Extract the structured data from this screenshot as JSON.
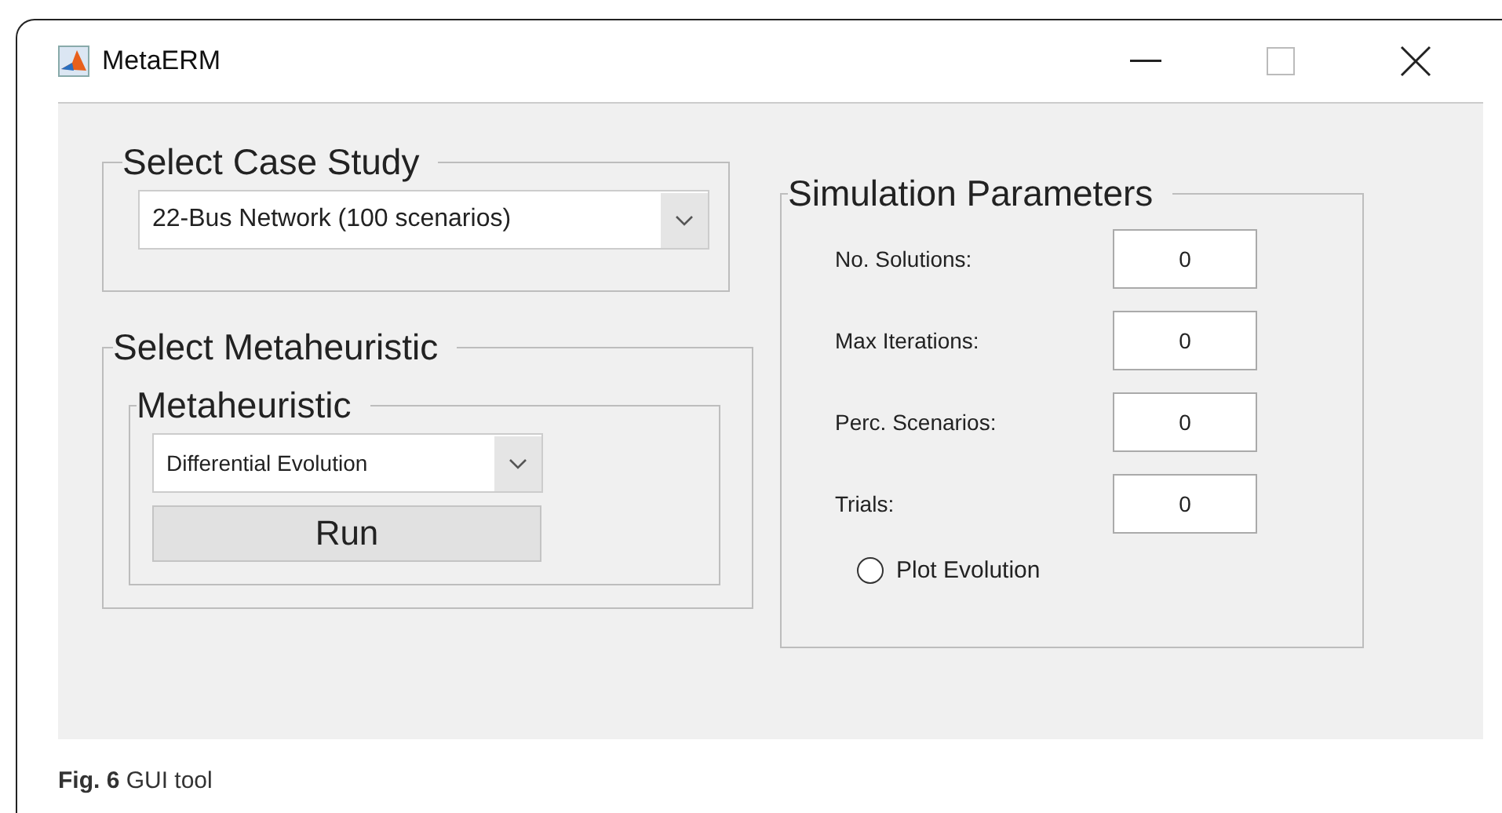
{
  "window": {
    "title": "MetaERM"
  },
  "case_study": {
    "title": "Select Case Study",
    "value": "22-Bus Network (100 scenarios)"
  },
  "metaheuristic_group": {
    "title": "Select Metaheuristic",
    "inner_title": "Metaheuristic",
    "value": "Differential Evolution",
    "run_button": "Run"
  },
  "simulation": {
    "title": "Simulation Parameters",
    "fields": [
      {
        "label": "No. Solutions:",
        "value": "0"
      },
      {
        "label": "Max Iterations:",
        "value": "0"
      },
      {
        "label": "Perc. Scenarios:",
        "value": "0"
      },
      {
        "label": "Trials:",
        "value": "0"
      }
    ],
    "plot_evolution": {
      "label": "Plot Evolution",
      "checked": false
    }
  },
  "caption": "**Fig. 6** GUI tool"
}
